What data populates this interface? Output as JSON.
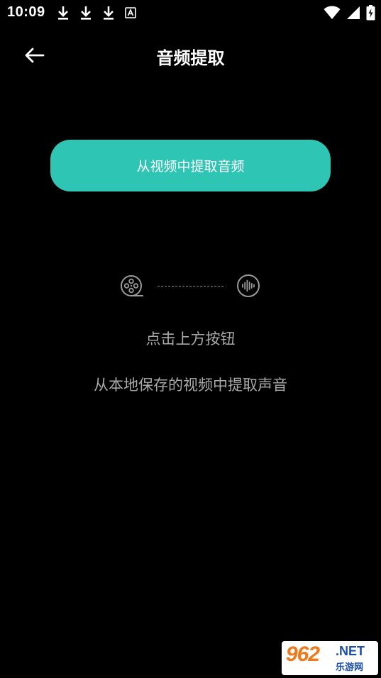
{
  "status_bar": {
    "time": "10:09",
    "left_icons": [
      "download-icon",
      "download-icon",
      "download-icon",
      "a-notification-icon"
    ],
    "right_icons": [
      "wifi-icon",
      "signal-icon",
      "battery-charging-icon"
    ]
  },
  "app_bar": {
    "back_icon": "arrow-left-icon",
    "title": "音频提取"
  },
  "main": {
    "extract_button_label": "从视频中提取音频",
    "flow_icons": [
      "film-reel-icon",
      "audio-wave-icon"
    ],
    "hint_line_1": "点击上方按钮",
    "hint_line_2": "从本地保存的视频中提取声音"
  },
  "watermark": {
    "number": "962",
    "domain": ".NET",
    "sub": "乐游网"
  },
  "colors": {
    "background": "#000000",
    "accent": "#2ec5b5",
    "hint_text": "#a9a9a9",
    "icon_gray": "#9a9a9a"
  }
}
